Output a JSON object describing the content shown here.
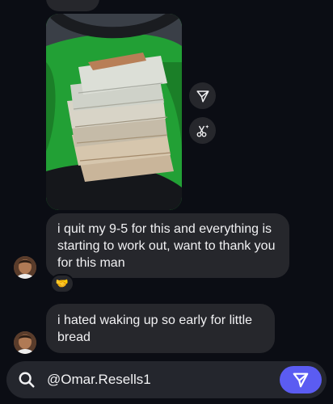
{
  "messages": [
    {
      "text": "i quit my 9-5 for this and everything is starting to work out, want to thank you for this man",
      "reaction": "🤝"
    },
    {
      "text": "i hated waking up so early for little bread"
    }
  ],
  "composer": {
    "value": "@Omar.Resells1"
  },
  "icons": {
    "forward": "paper-plane-icon",
    "ai_edit": "scissors-sparkle-icon",
    "search": "search-icon",
    "send": "send-icon"
  },
  "colors": {
    "background": "#0b0d14",
    "bubble": "#26272c",
    "send_button": "#5b5cf2"
  }
}
